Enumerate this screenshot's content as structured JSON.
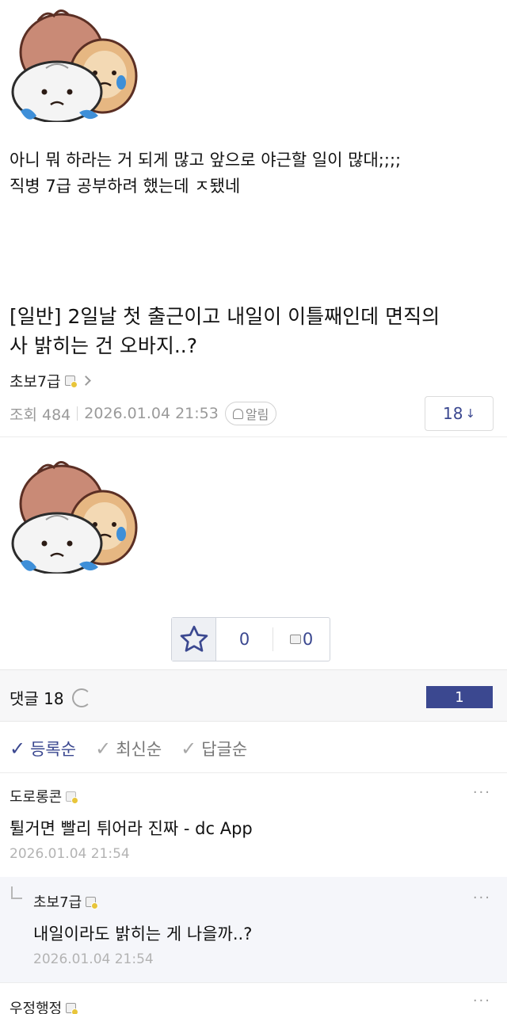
{
  "post": {
    "body_lines": [
      "아니 뭐 하라는 거 되게 많고 앞으로 야근할 일이 많대;;;;",
      "직병 7급 공부하려 했는데 ㅈ됐네"
    ]
  },
  "next_post": {
    "title_lines": [
      "[일반] 2일날 첫 출근이고 내일이 이틀째인데 면직의",
      "사 밝히는 건 오바지..?"
    ],
    "author": "초보7급",
    "views_label": "조회 484",
    "date": "2026.01.04 21:53",
    "alarm_label": "알림",
    "reply_count": "18",
    "reply_arrow": "↓"
  },
  "recommend": {
    "up_count": "0",
    "down_count": "0"
  },
  "comments_header": {
    "label": "댓글 18",
    "page": "1"
  },
  "sort": {
    "items": [
      {
        "label": "등록순",
        "check": "✓"
      },
      {
        "label": "최신순",
        "check": "✓"
      },
      {
        "label": "답글순",
        "check": "✓"
      }
    ]
  },
  "comments": [
    {
      "author": "도로롱콘",
      "text": "튈거면 빨리 튀어라 진짜 - dc App",
      "date": "2026.01.04 21:54",
      "more": "···"
    },
    {
      "author": "초보7급",
      "text": "내일이라도 밝히는 게 나을까..?",
      "date": "2026.01.04 21:54",
      "more": "···"
    },
    {
      "author": "우정행정",
      "more": "···"
    }
  ],
  "colors": {
    "accent": "#3b4890",
    "meta_gray": "#9a9a9a",
    "reply_bg": "#f5f6fa"
  }
}
